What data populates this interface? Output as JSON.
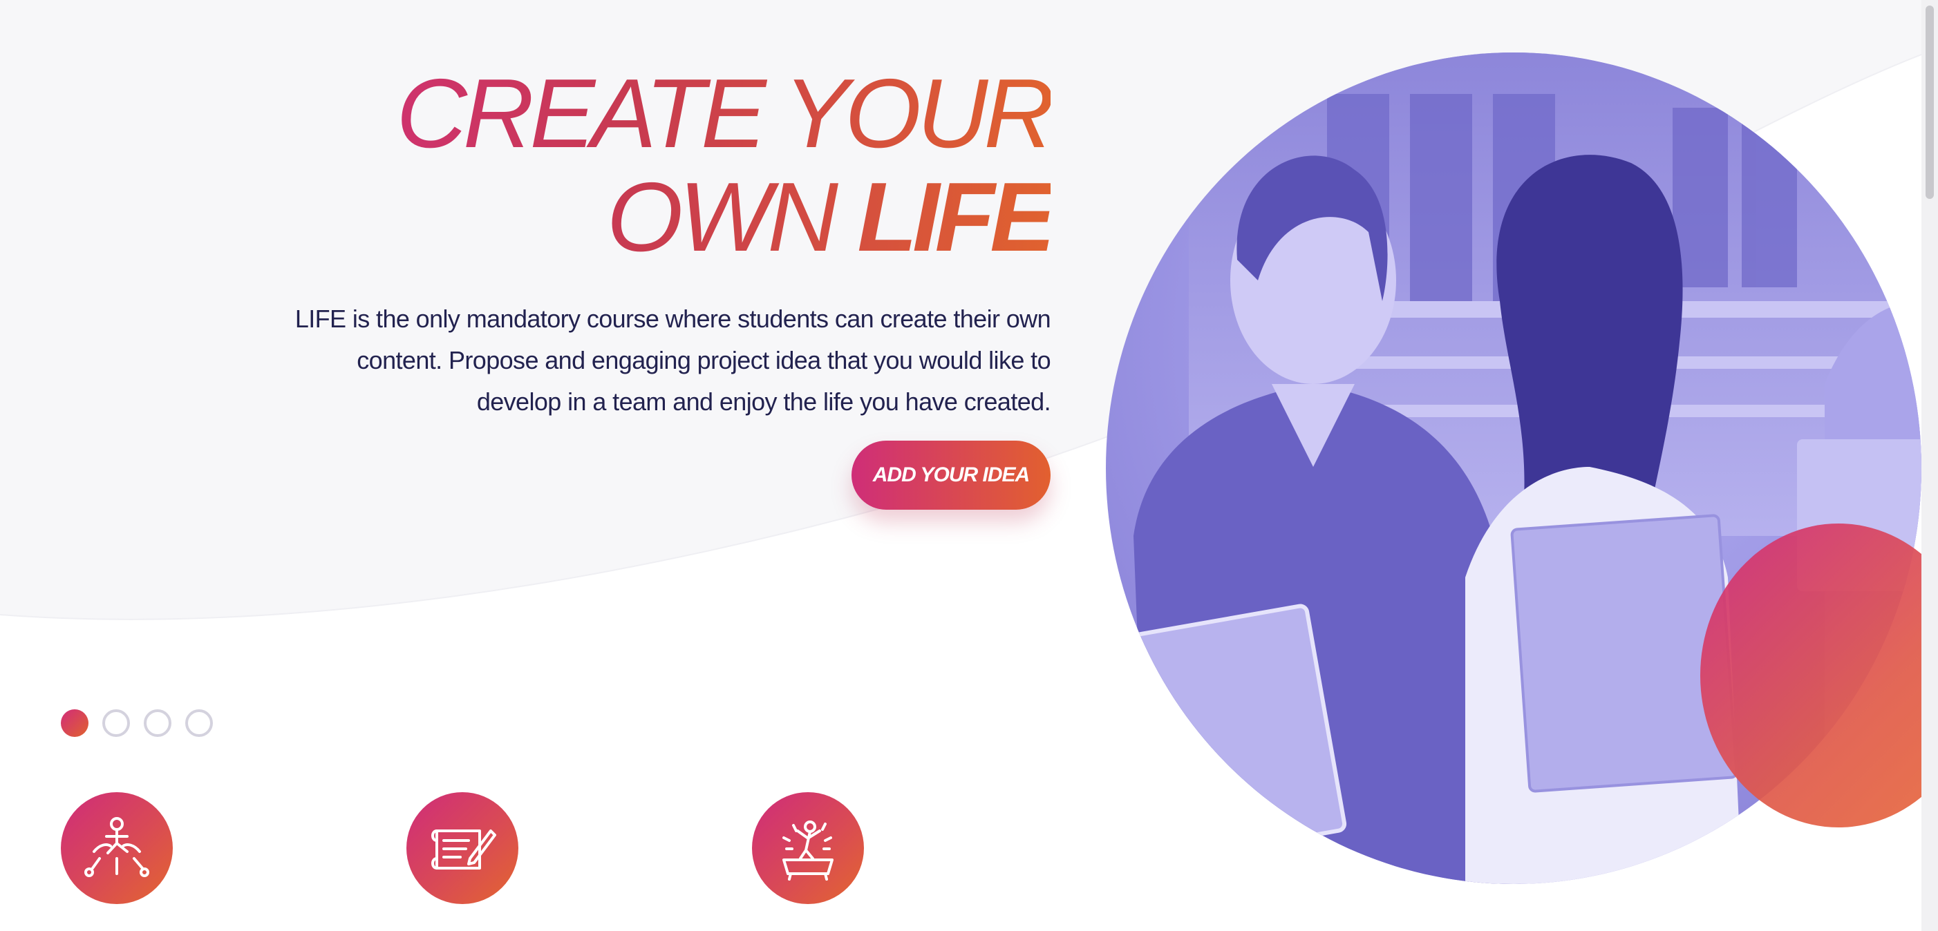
{
  "hero": {
    "headline_line1": "CREATE YOUR",
    "headline_line2_light": "OWN",
    "headline_line2_strong": "LIFE",
    "description_lines": [
      "LIFE is the only mandatory course where students can create their own",
      "content. Propose and engaging project idea that you would like to",
      "develop in a team and enjoy the life you have created."
    ],
    "cta_label": "ADD YOUR IDEA"
  },
  "carousel": {
    "slide_count": 4,
    "active_index": 0
  },
  "features": [
    {
      "icon": "collaboration-icon"
    },
    {
      "icon": "writing-scroll-icon"
    },
    {
      "icon": "celebration-bath-icon"
    }
  ],
  "colors": {
    "gradient_start": "#d12c79",
    "gradient_end": "#e3662f",
    "text_dark": "#22224f",
    "photo_tint": "#9f99e6"
  }
}
